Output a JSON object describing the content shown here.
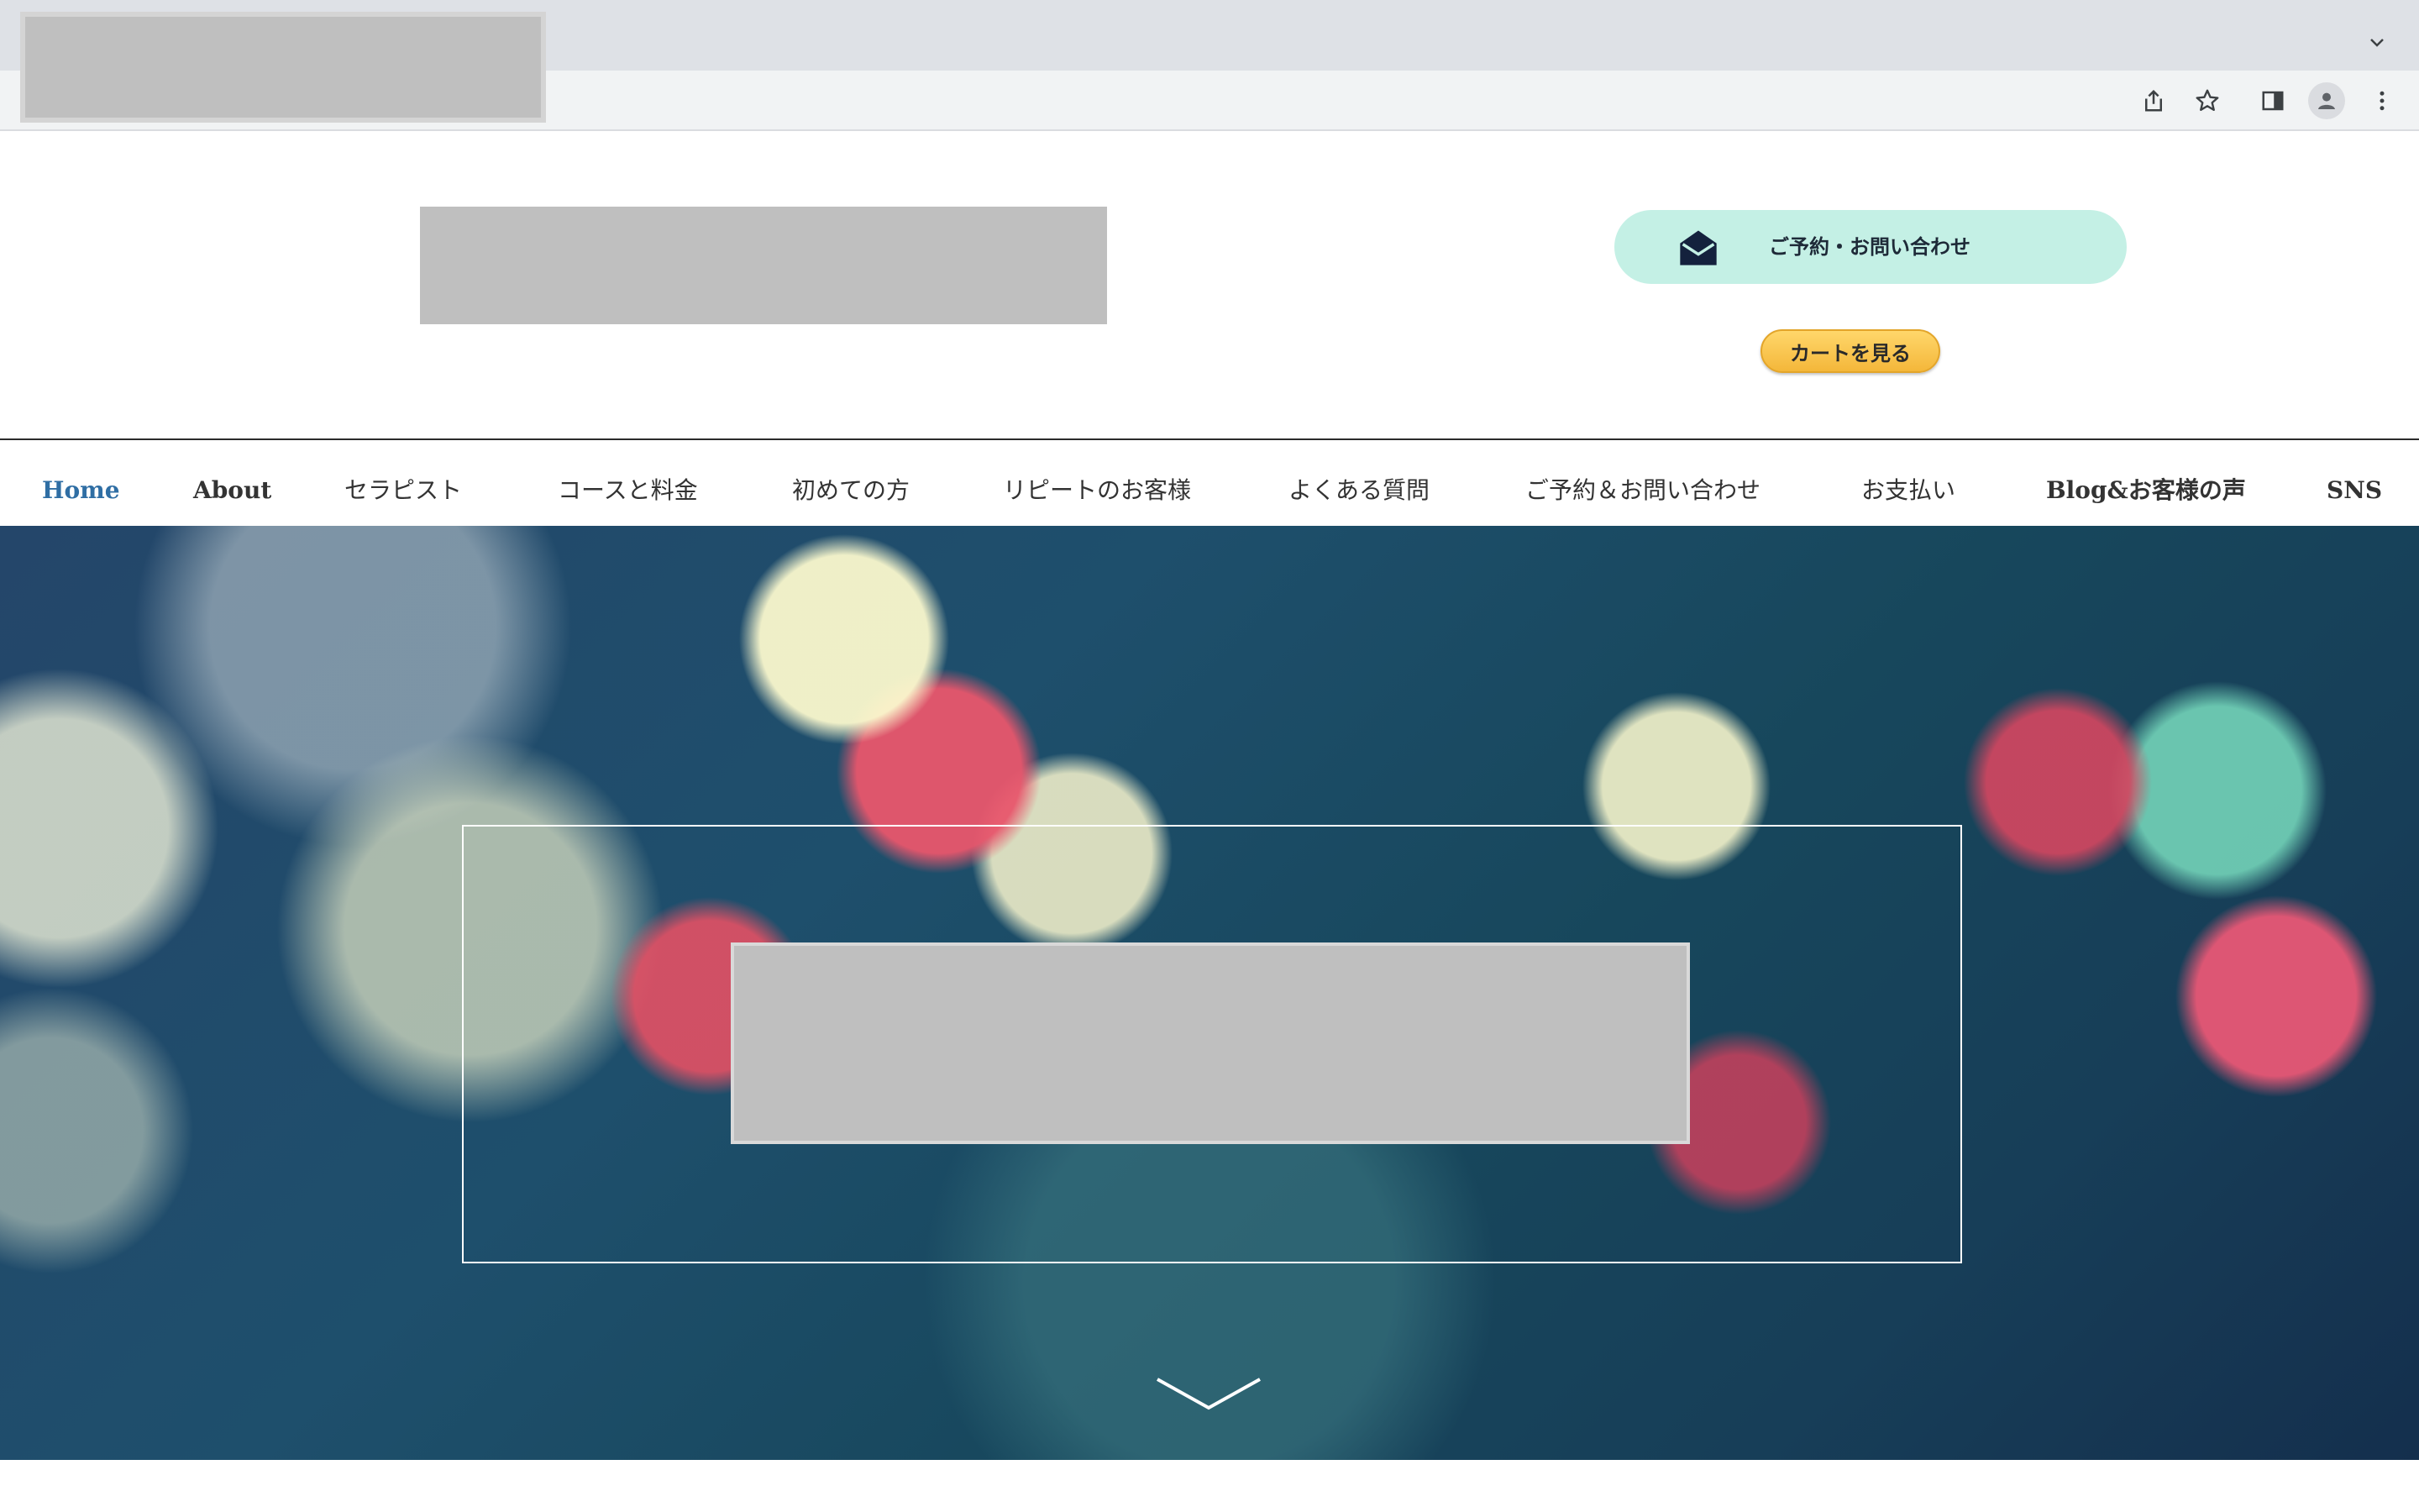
{
  "browser": {
    "tab_title": "",
    "address": "",
    "toolbar_icons": [
      "share-icon",
      "star-icon",
      "side-panel-icon",
      "profile-icon",
      "menu-icon"
    ]
  },
  "header": {
    "logo_text": "",
    "contact_button": {
      "label": "ご予約・お問い合わせ",
      "icon": "envelope-open-icon",
      "color": "#c4f0e5"
    },
    "cart_button": {
      "label": "カートを見る",
      "color": "#f4b73a"
    }
  },
  "nav": {
    "items": [
      {
        "label": "Home",
        "active": true
      },
      {
        "label": "About",
        "active": false
      },
      {
        "label": "セラピスト",
        "active": false
      },
      {
        "label": "コースと料金",
        "active": false
      },
      {
        "label": "初めての方",
        "active": false
      },
      {
        "label": "リピートのお客様",
        "active": false
      },
      {
        "label": "よくある質問",
        "active": false
      },
      {
        "label": "ご予約＆お問い合わせ",
        "active": false
      },
      {
        "label": "お支払い",
        "active": false
      },
      {
        "label": "Blog&お客様の声",
        "active": false
      },
      {
        "label": "SNS",
        "active": false
      }
    ],
    "active_color": "#2f6ea4"
  },
  "hero": {
    "heading": "",
    "scroll_icon": "chevron-down-icon"
  }
}
